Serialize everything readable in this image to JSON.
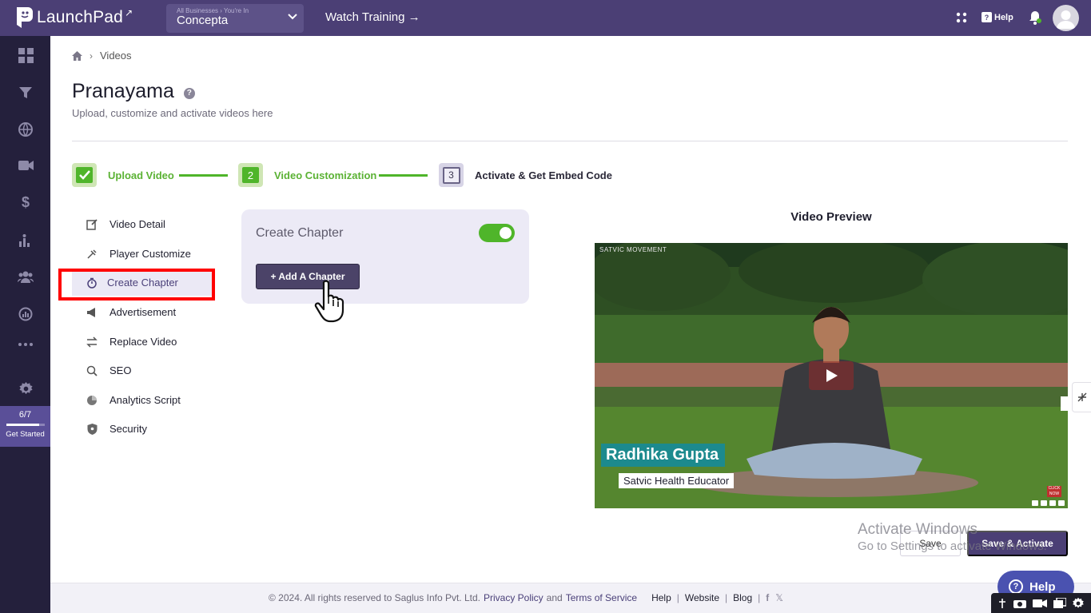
{
  "app": {
    "logo_text": "LaunchPad",
    "business_sub": "All Businesses › You're In",
    "business_name": "Concepta",
    "watch_training": "Watch Training →",
    "help_label": "Help"
  },
  "sidebar": {
    "icons": [
      "dashboard-icon",
      "funnel-icon",
      "globe-icon",
      "video-icon",
      "dollar-icon",
      "chart-icon",
      "users-icon",
      "gauge-icon",
      "more-icon",
      "settings-icon"
    ],
    "get_started": {
      "count": "6/7",
      "label": "Get Started",
      "progress": 0.857
    }
  },
  "breadcrumb": {
    "current": "Videos"
  },
  "page": {
    "title": "Pranayama",
    "subtitle": "Upload, customize and activate videos here"
  },
  "stepper": {
    "steps": [
      {
        "number": "✓",
        "label": "Upload Video",
        "state": "done"
      },
      {
        "number": "2",
        "label": "Video Customization",
        "state": "done"
      },
      {
        "number": "3",
        "label": "Activate & Get Embed Code",
        "state": "pending"
      }
    ],
    "accent_color": "#4fb52a"
  },
  "submenu": {
    "items": [
      {
        "label": "Video Detail",
        "icon": "edit-icon"
      },
      {
        "label": "Player Customize",
        "icon": "palette-icon"
      },
      {
        "label": "Create Chapter",
        "icon": "timer-icon",
        "active": true
      },
      {
        "label": "Advertisement",
        "icon": "megaphone-icon"
      },
      {
        "label": "Replace Video",
        "icon": "swap-icon"
      },
      {
        "label": "SEO",
        "icon": "search-icon"
      },
      {
        "label": "Analytics Script",
        "icon": "pie-icon"
      },
      {
        "label": "Security",
        "icon": "shield-icon"
      }
    ]
  },
  "chapter": {
    "title": "Create Chapter",
    "toggle_on": true,
    "add_button": "+ Add A Chapter"
  },
  "preview": {
    "title": "Video Preview",
    "brand": "SATVIC MOVEMENT",
    "name": "Radhika Gupta",
    "role": "Satvic Health Educator",
    "click_now": "CLICK NOW"
  },
  "actions": {
    "save": "Save",
    "save_activate": "Save & Activate"
  },
  "watermark": {
    "line1": "Activate Windows",
    "line2": "Go to Settings to activate Windows."
  },
  "footer": {
    "copyright": "©  2024. All rights reserved to Saglus Info Pvt. Ltd.",
    "privacy": "Privacy Policy",
    "and": "and",
    "terms": "Terms of Service",
    "help": "Help",
    "website": "Website",
    "blog": "Blog"
  },
  "help_fab": {
    "label": "Help"
  },
  "colors": {
    "brand": "#4b3f75",
    "sidebar": "#24203c",
    "success": "#4fb52a",
    "highlight": "#ff0000"
  }
}
